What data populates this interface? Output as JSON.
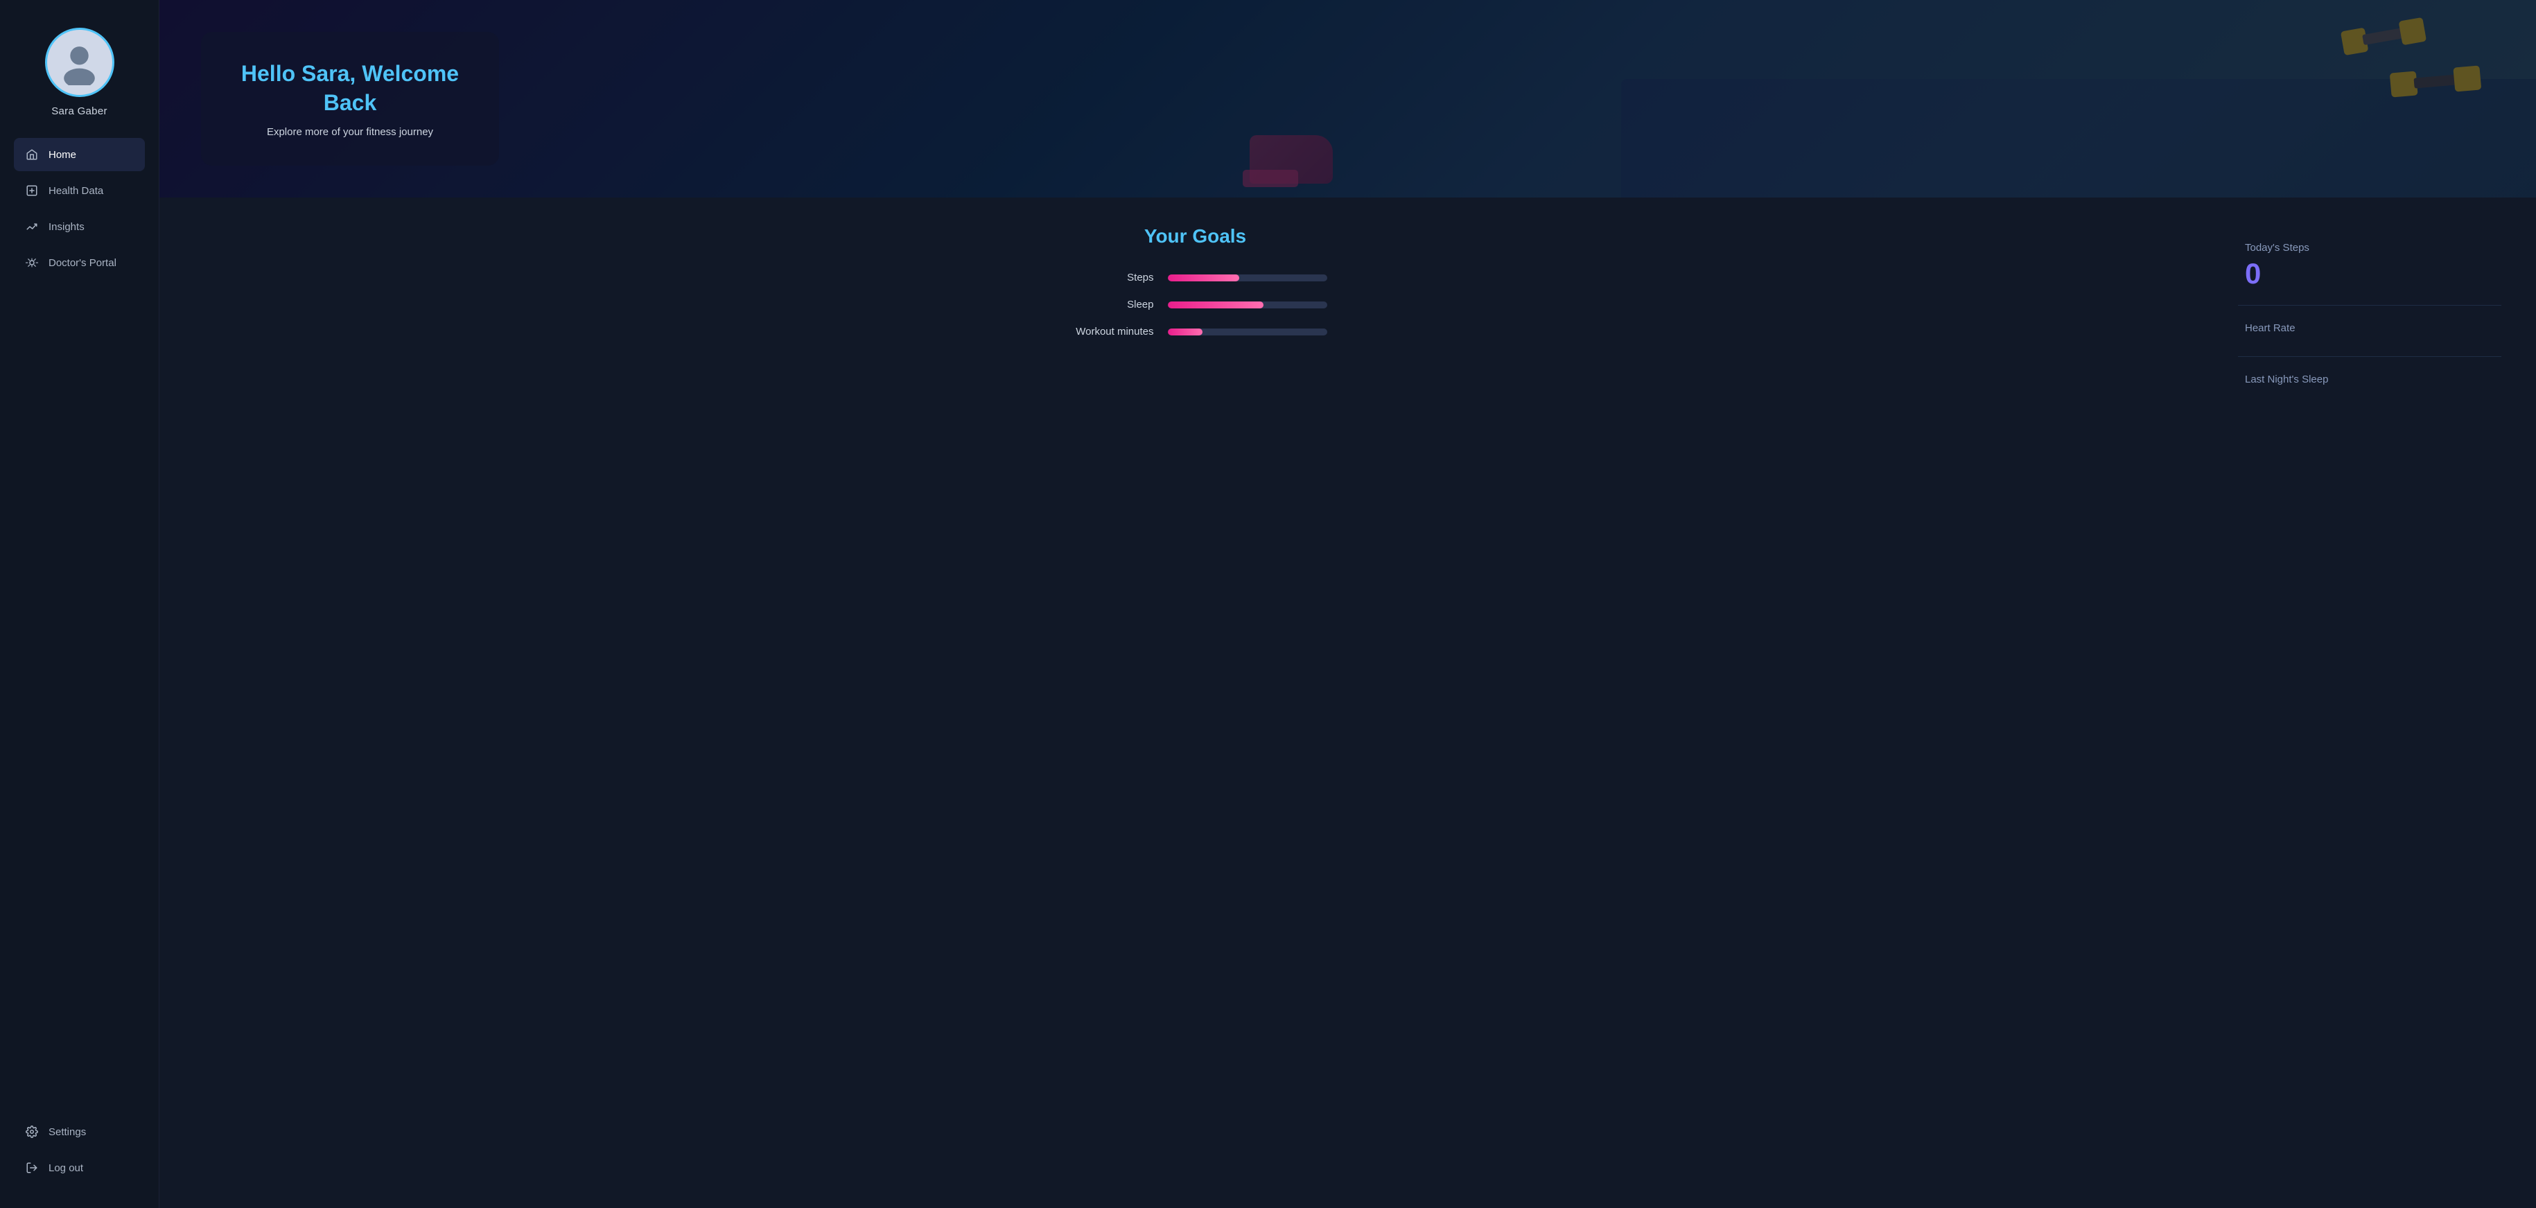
{
  "sidebar": {
    "user": {
      "name": "Sara Gaber"
    },
    "nav_items": [
      {
        "id": "home",
        "label": "Home",
        "icon": "home-icon",
        "active": true
      },
      {
        "id": "health-data",
        "label": "Health Data",
        "icon": "health-icon",
        "active": false
      },
      {
        "id": "insights",
        "label": "Insights",
        "icon": "insights-icon",
        "active": false
      },
      {
        "id": "doctors-portal",
        "label": "Doctor's Portal",
        "icon": "doctors-icon",
        "active": false
      }
    ],
    "bottom_items": [
      {
        "id": "settings",
        "label": "Settings",
        "icon": "settings-icon"
      },
      {
        "id": "logout",
        "label": "Log out",
        "icon": "logout-icon"
      }
    ]
  },
  "hero": {
    "title": "Hello Sara, Welcome Back",
    "subtitle": "Explore more of your fitness journey"
  },
  "goals": {
    "title": "Your Goals",
    "items": [
      {
        "label": "Steps",
        "fill_percent": 45
      },
      {
        "label": "Sleep",
        "fill_percent": 60
      },
      {
        "label": "Workout minutes",
        "fill_percent": 22
      }
    ]
  },
  "stats": {
    "today_steps": {
      "label": "Today's Steps",
      "value": "0"
    },
    "heart_rate": {
      "label": "Heart Rate",
      "value": ""
    },
    "last_nights_sleep": {
      "label": "Last Night's Sleep",
      "value": ""
    }
  },
  "colors": {
    "accent_blue": "#4fc3f7",
    "accent_pink": "#e91e8c",
    "accent_purple": "#7c6ef7",
    "sidebar_bg": "#0f1623",
    "main_bg": "#111827"
  }
}
